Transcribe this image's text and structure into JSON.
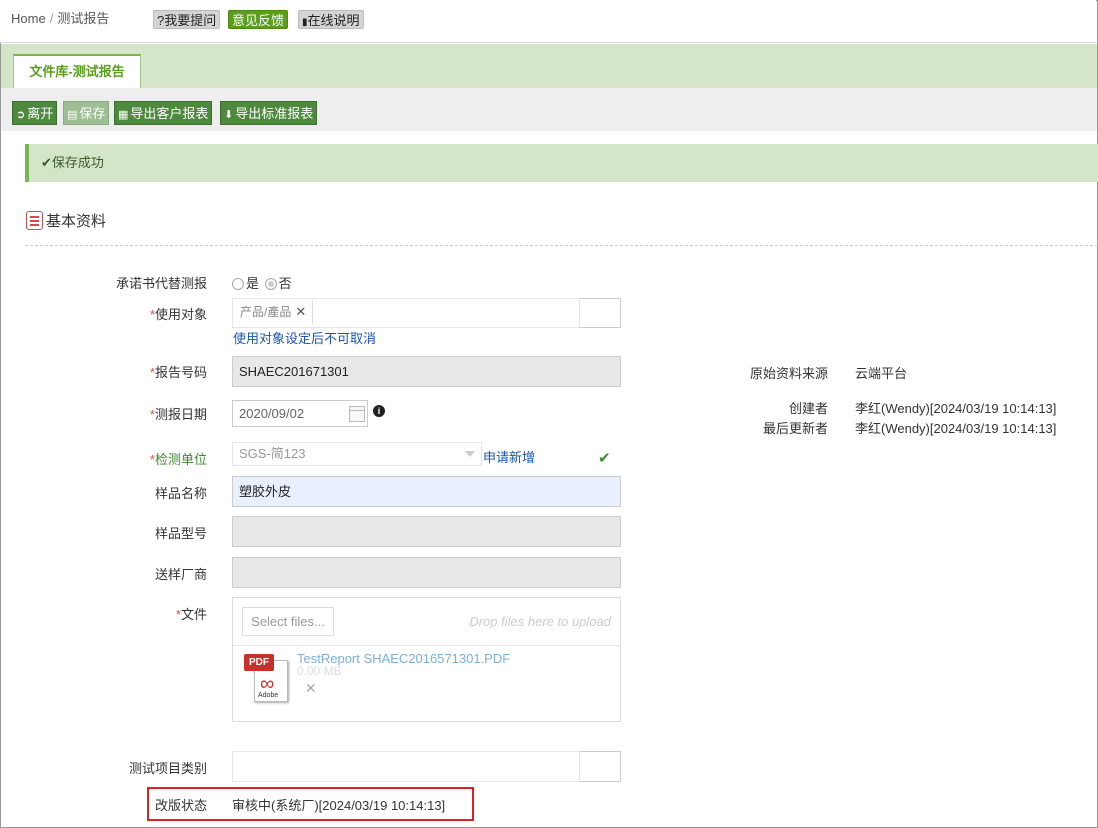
{
  "breadcrumb": {
    "home": "Home",
    "separator": "/",
    "current": "测试报告"
  },
  "top_buttons": {
    "ask": "?我要提问",
    "feedback": "意见反馈",
    "manual": "在线说明"
  },
  "tab": {
    "label": "文件库-测试报告"
  },
  "toolbar": {
    "leave": "离开",
    "save": "保存",
    "export_customer": "导出客户报表",
    "export_standard": "导出标准报表"
  },
  "alert": {
    "message": "保存成功"
  },
  "section": {
    "title": "基本资料"
  },
  "form": {
    "commitment": {
      "label": "承诺书代替测报",
      "yes": "是",
      "no": "否",
      "selected": "no"
    },
    "target": {
      "label": "使用对象",
      "tag": "产品/產品",
      "note": "使用对象设定后不可取消"
    },
    "report_no": {
      "label": "报告号码",
      "value": "SHAEC201671301"
    },
    "report_date": {
      "label": "测报日期",
      "value": "2020/09/02"
    },
    "lab": {
      "label": "检测单位",
      "value": "SGS-简123",
      "apply_link": "申请新增"
    },
    "sample_name": {
      "label": "样品名称",
      "value": "塑胶外皮"
    },
    "sample_model": {
      "label": "样品型号",
      "value": ""
    },
    "vendor": {
      "label": "送样厂商",
      "value": ""
    },
    "file": {
      "label": "文件",
      "select_button": "Select files...",
      "drop_hint": "Drop files here to upload",
      "file_name": "TestReport  SHAEC2016571301.PDF",
      "file_size": "0.00 MB",
      "pdf_badge": "PDF",
      "pdf_vendor": "Adobe"
    },
    "test_category": {
      "label": "测试项目类别",
      "value": ""
    },
    "revision_status": {
      "label": "改版状态",
      "value": "审核中(系统厂)[2024/03/19 10:14:13]"
    }
  },
  "meta": {
    "source": {
      "label": "原始资料来源",
      "value": "云端平台"
    },
    "creator": {
      "label": "创建者",
      "value": "李红(Wendy)[2024/03/19 10:14:13]"
    },
    "updater": {
      "label": "最后更新者",
      "value": "李红(Wendy)[2024/03/19 10:14:13]"
    }
  },
  "colors": {
    "accent_green": "#5a9e1b",
    "button_green": "#4e8a3e",
    "required": "#d9534f",
    "link": "#1a55b5",
    "highlight_box": "#e02020"
  }
}
